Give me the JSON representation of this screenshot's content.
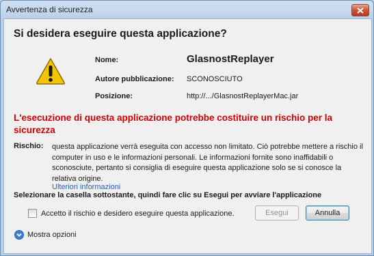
{
  "window": {
    "title": "Avvertenza di sicurezza"
  },
  "dialog": {
    "heading": "Si desidera eseguire questa applicazione?",
    "fields": {
      "name_label": "Nome:",
      "name_value": "GlasnostReplayer",
      "publisher_label": "Autore pubblicazione:",
      "publisher_value": "SCONOSCIUTO",
      "location_label": "Posizione:",
      "location_value": "http://.../GlasnostReplayerMac.jar"
    },
    "risk_headline": "L'esecuzione di questa applicazione potrebbe costituire un rischio per la sicurezza",
    "risk_label": "Rischio:",
    "risk_text": "questa applicazione verrà eseguita con accesso non limitato. Ciò potrebbe mettere a rischio il computer in uso e le informazioni personali. Le informazioni fornite sono inaffidabili o sconosciute, pertanto si consiglia di eseguire questa applicazione solo se si conosce la relativa origine.",
    "more_info_link": "Ulteriori informazioni",
    "instruction": "Selezionare la casella sottostante, quindi fare clic su Esegui per avviare l'applicazione",
    "accept_checkbox_label": "Accetto il rischio e desidero eseguire questa applicazione.",
    "accept_checked": false,
    "run_button": "Esegui",
    "cancel_button": "Annulla",
    "show_options": "Mostra opzioni"
  },
  "colors": {
    "risk": "#cc0000",
    "link": "#2a5db0",
    "warning_fill": "#f5c400"
  },
  "icons": {
    "warning": "warning-triangle-icon",
    "close": "close-icon",
    "options": "chevron-down-circle-icon"
  }
}
